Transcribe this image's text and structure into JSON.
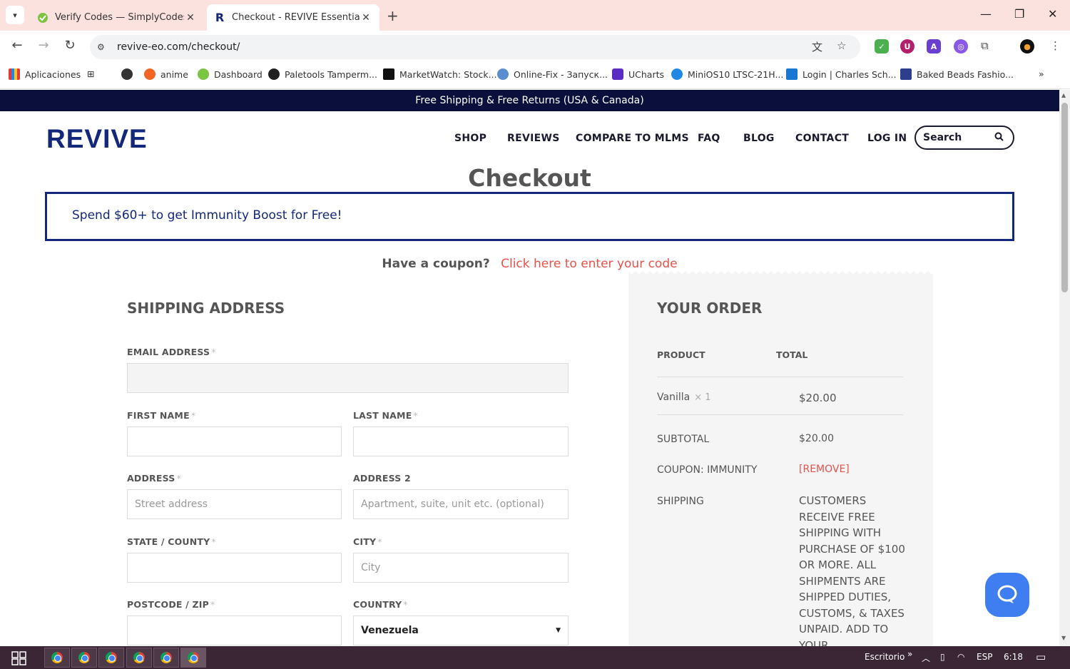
{
  "browser": {
    "tabs": [
      {
        "title": "Verify Codes — SimplyCodes",
        "active": false
      },
      {
        "title": "Checkout - REVIVE Essential Oils",
        "active": true
      }
    ],
    "url": "revive-eo.com/checkout/",
    "bookmarks": [
      "Aplicaciones",
      "anime",
      "Dashboard",
      "Paletools Tamperm...",
      "MarketWatch: Stock...",
      "Online-Fix - Запуск...",
      "UCharts",
      "MiniOS10 LTSC-21H...",
      "Login | Charles Sch...",
      "Baked Beads Fashio..."
    ]
  },
  "site": {
    "promo": "Free Shipping & Free Returns (USA & Canada)",
    "logo": "REVIVE",
    "nav": [
      "SHOP",
      "REVIEWS",
      "COMPARE TO MLMS",
      "FAQ",
      "BLOG",
      "CONTACT",
      "LOG IN"
    ],
    "search_placeholder": "Search"
  },
  "checkout": {
    "title": "Checkout",
    "notice": "Spend $60+ to get Immunity Boost for Free!",
    "coupon_question": "Have a coupon?",
    "coupon_link": "Click here to enter your code",
    "shipping": {
      "title": "SHIPPING ADDRESS",
      "email_label": "EMAIL ADDRESS",
      "first_name_label": "FIRST NAME",
      "last_name_label": "LAST NAME",
      "address_label": "ADDRESS",
      "address_placeholder": "Street address",
      "address2_label": "ADDRESS 2",
      "address2_placeholder": "Apartment, suite, unit etc. (optional)",
      "state_label": "STATE / COUNTY",
      "city_label": "CITY",
      "city_placeholder": "City",
      "postcode_label": "POSTCODE / ZIP",
      "country_label": "COUNTRY",
      "country_value": "Venezuela",
      "required_mark": "*"
    },
    "order": {
      "title": "YOUR ORDER",
      "col_product": "PRODUCT",
      "col_total": "TOTAL",
      "item_name": "Vanilla",
      "item_qty": "× 1",
      "item_total": "$20.00",
      "subtotal_label": "SUBTOTAL",
      "subtotal_value": "$20.00",
      "coupon_label": "COUPON: IMMUNITY",
      "coupon_remove": "[REMOVE]",
      "shipping_label": "SHIPPING",
      "shipping_text": "Customers receive free shipping with purchase of $100 or more. All shipments are shipped duties, customs, & taxes unpaid. Add to your"
    }
  },
  "taskbar": {
    "desktop_label": "Escritorio",
    "language": "ESP",
    "time": "6:18"
  },
  "colors": {
    "brand_navy": "#13287a",
    "promo_bg": "#0a0f3c",
    "link_red": "#e8514a",
    "help_blue": "#3f7ef0"
  }
}
